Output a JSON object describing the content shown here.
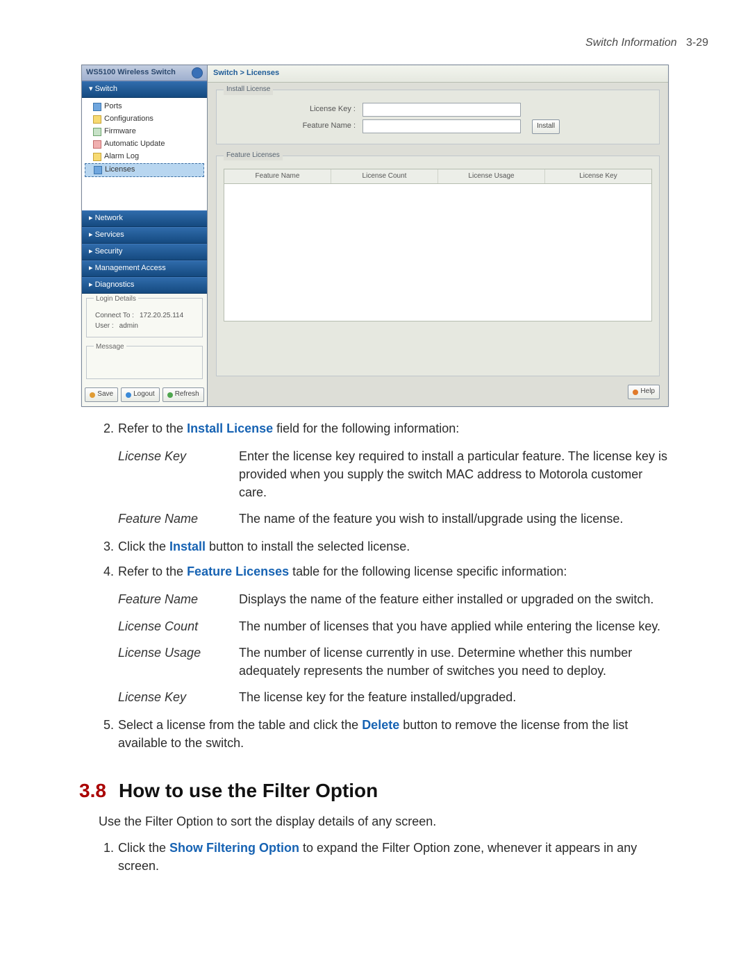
{
  "running_head": {
    "title": "Switch Information",
    "page": "3-29"
  },
  "screenshot": {
    "brand": "WS5100 Wireless Switch",
    "breadcrumb": "Switch > Licenses",
    "nav": {
      "switch": "Switch",
      "tree": {
        "ports": "Ports",
        "configs": "Configurations",
        "firmware": "Firmware",
        "auto_update": "Automatic Update",
        "alarm_log": "Alarm Log",
        "licenses": "Licenses"
      },
      "network": "Network",
      "services": "Services",
      "security": "Security",
      "mgmt": "Management Access",
      "diag": "Diagnostics"
    },
    "login": {
      "title": "Login Details",
      "connect_label": "Connect To :",
      "connect_value": "172.20.25.114",
      "user_label": "User :",
      "user_value": "admin"
    },
    "message": {
      "title": "Message"
    },
    "bottom": {
      "save": "Save",
      "logout": "Logout",
      "refresh": "Refresh"
    },
    "install_group": {
      "title": "Install License",
      "license_key_label": "License Key :",
      "feature_name_label": "Feature Name :",
      "install_btn": "Install"
    },
    "feature_group": {
      "title": "Feature Licenses",
      "cols": {
        "c1": "Feature Name",
        "c2": "License Count",
        "c3": "License Usage",
        "c4": "License Key"
      }
    },
    "help": "Help"
  },
  "doc": {
    "step2": {
      "num": "2.",
      "pre": "Refer to the ",
      "kw": "Install License",
      "post": " field for the following information:"
    },
    "gloss1": [
      {
        "term": "License Key",
        "def": "Enter the license key required to install a particular feature. The license key is provided when you supply the switch MAC address to Motorola customer care."
      },
      {
        "term": "Feature Name",
        "def": "The name of the feature you wish to install/upgrade using the license."
      }
    ],
    "step3": {
      "num": "3.",
      "pre": "Click the ",
      "kw": "Install",
      "post": " button to install the selected license."
    },
    "step4": {
      "num": "4.",
      "pre": "Refer to the ",
      "kw": "Feature Licenses",
      "post": " table for the following license specific information:"
    },
    "gloss2": [
      {
        "term": "Feature Name",
        "def": "Displays the name of the feature either installed or upgraded on the switch."
      },
      {
        "term": "License Count",
        "def": "The number of licenses that you have applied while entering the license key."
      },
      {
        "term": "License Usage",
        "def": "The number of license currently in use. Determine whether this number adequately represents the number of switches you need to deploy."
      },
      {
        "term": "License Key",
        "def": "The license key for the feature installed/upgraded."
      }
    ],
    "step5": {
      "num": "5.",
      "pre": "Select a license from the table and click the ",
      "kw": "Delete",
      "post": " button to remove the license from the list available to the switch."
    },
    "section": {
      "no": "3.8",
      "title": "How to use the Filter Option"
    },
    "sec_body": "Use the Filter Option to sort the display details of any screen.",
    "sec_step1": {
      "num": "1.",
      "pre": "Click the ",
      "kw": "Show Filtering Option",
      "post": " to expand the Filter Option zone, whenever it appears in any screen."
    }
  }
}
